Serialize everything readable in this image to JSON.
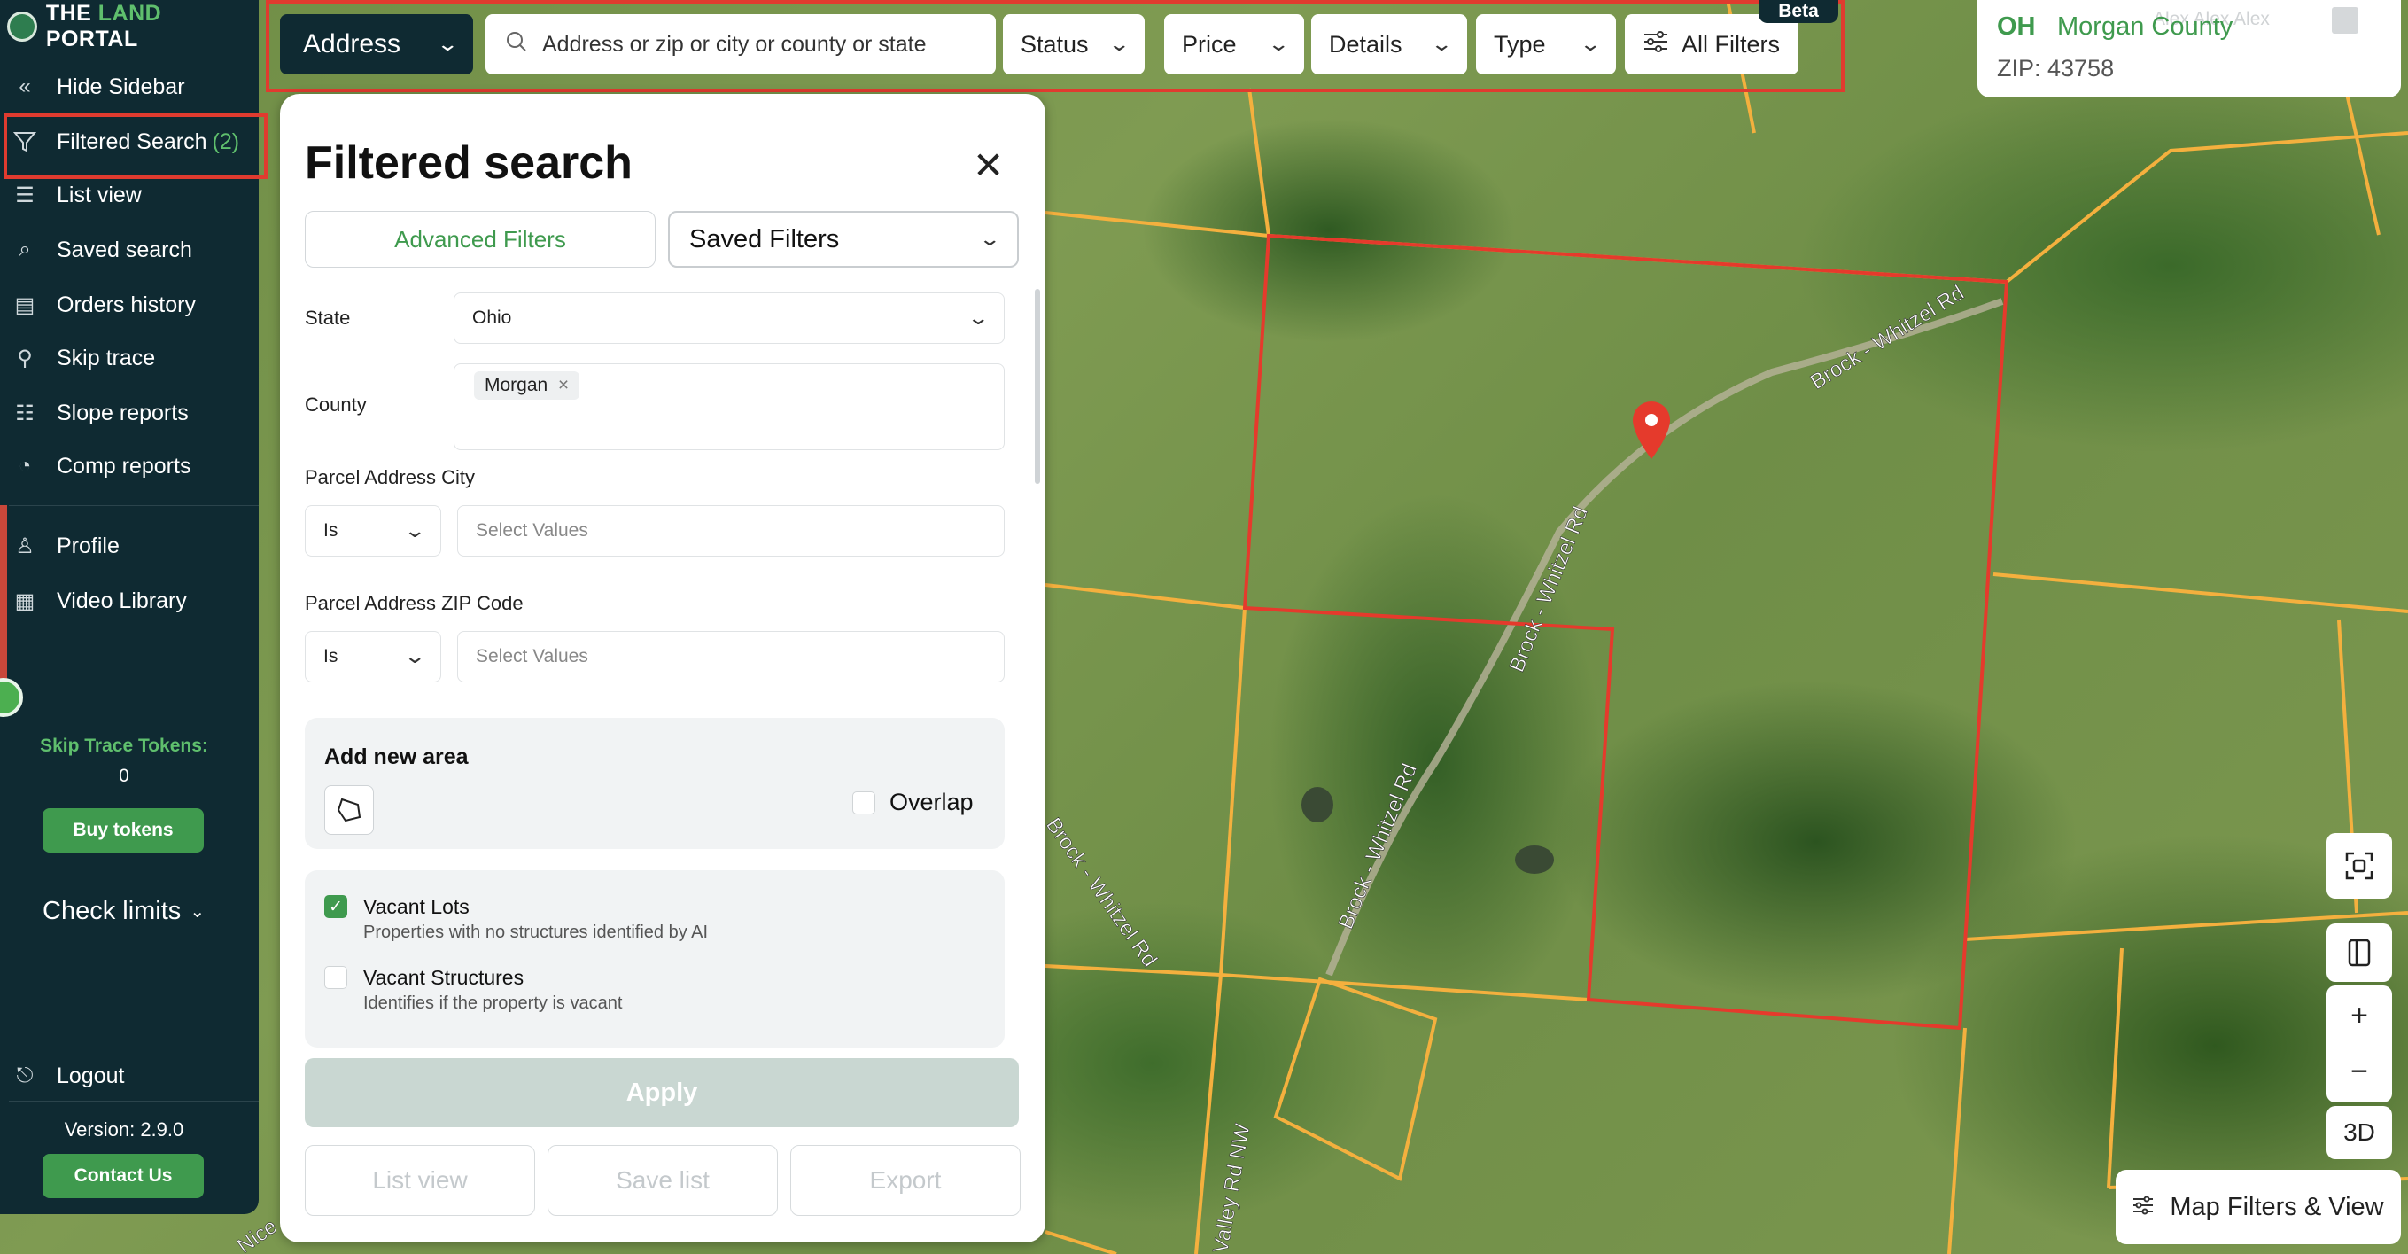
{
  "sidebar": {
    "logo_text_a": "THE ",
    "logo_text_b": "LAND",
    "logo_text_c": " PORTAL",
    "items": [
      {
        "label": "Hide Sidebar",
        "icon": "double-chevron-left-icon"
      },
      {
        "label": "Filtered Search",
        "icon": "filter-icon",
        "count": "(2)"
      },
      {
        "label": "List view",
        "icon": "list-icon"
      },
      {
        "label": "Saved search",
        "icon": "saved-search-icon"
      },
      {
        "label": "Orders history",
        "icon": "orders-icon"
      },
      {
        "label": "Skip trace",
        "icon": "skip-trace-icon"
      },
      {
        "label": "Slope reports",
        "icon": "slope-icon"
      },
      {
        "label": "Comp reports",
        "icon": "pie-chart-icon"
      },
      {
        "label": "Profile",
        "icon": "user-icon"
      },
      {
        "label": "Video Library",
        "icon": "video-icon"
      }
    ],
    "tokens_label": "Skip Trace Tokens:",
    "tokens_value": "0",
    "buy_tokens": "Buy tokens",
    "check_limits": "Check limits",
    "logout": "Logout",
    "version": "Version: 2.9.0",
    "contact_us": "Contact Us"
  },
  "topbar": {
    "address_select": "Address",
    "search_placeholder": "Address or zip or city or county or state",
    "status": "Status",
    "price": "Price",
    "details": "Details",
    "type": "Type",
    "all_filters": "All Filters",
    "beta": "Beta"
  },
  "panel": {
    "title": "Filtered search",
    "tab_advanced": "Advanced Filters",
    "tab_saved": "Saved Filters",
    "state_label": "State",
    "state_value": "Ohio",
    "county_label": "County",
    "county_tag": "Morgan",
    "city_label": "Parcel Address City",
    "city_op": "Is",
    "city_placeholder": "Select Values",
    "zip_label": "Parcel Address ZIP Code",
    "zip_op": "Is",
    "zip_placeholder": "Select Values",
    "area_title": "Add new area",
    "overlap": "Overlap",
    "vacant_lots": "Vacant Lots",
    "vacant_lots_desc": "Properties with no structures identified by AI",
    "vacant_lots_checked": true,
    "vacant_structures": "Vacant Structures",
    "vacant_structures_desc": "Identifies if the property is vacant",
    "vacant_structures_checked": false,
    "apply": "Apply",
    "list_view": "List view",
    "save_list": "Save list",
    "export": "Export"
  },
  "info_card": {
    "state": "OH",
    "county": "Morgan County",
    "user": "Alex Alex Alex",
    "zip": "ZIP: 43758"
  },
  "map": {
    "roads": [
      "Brock - Whitzel Rd",
      "Brock - Whitzel Rd",
      "Brock - Whitzel Rd",
      "Brock - Whitzel Rd",
      "Valley Rd NW",
      "Nice"
    ],
    "controls": {
      "zoom_in": "+",
      "zoom_out": "−",
      "three_d": "3D"
    },
    "map_filters": "Map Filters & View"
  },
  "colors": {
    "accent": "#3f9a4e",
    "sidebar_bg": "#0f2a32",
    "highlight": "#e03b2f",
    "parcel_line": "#f4b03e"
  }
}
